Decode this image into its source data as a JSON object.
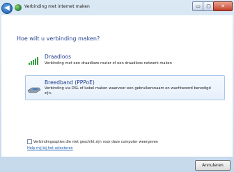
{
  "window": {
    "title": "Verbinding met internet maken",
    "controls": {
      "minimize": "▭",
      "maximize": "▢",
      "close": "✕"
    },
    "back_glyph": "◀"
  },
  "main": {
    "heading": "Hoe wilt u verbinding maken?",
    "options": [
      {
        "title": "Draadloos",
        "description": "Verbinding met een draadloze router of een draadloos netwerk maken",
        "icon": "wifi-signal-icon"
      },
      {
        "title": "Breedband (PPPoE)",
        "description": "Verbinding via DSL of kabel maken waarvoor een gebruikersnaam en wachtwoord benodigd zijn.",
        "icon": "network-cable-icon",
        "selected": true
      }
    ],
    "checkbox_label": "Verbindingsopties die niet geschikt zijn voor deze computer weergeven",
    "help_link": "Help mij bij het selecteren"
  },
  "footer": {
    "cancel_label": "Annuleren"
  },
  "colors": {
    "heading": "#1f3e8c",
    "link": "#1a5fb4",
    "frame": "#c5d9ec"
  }
}
